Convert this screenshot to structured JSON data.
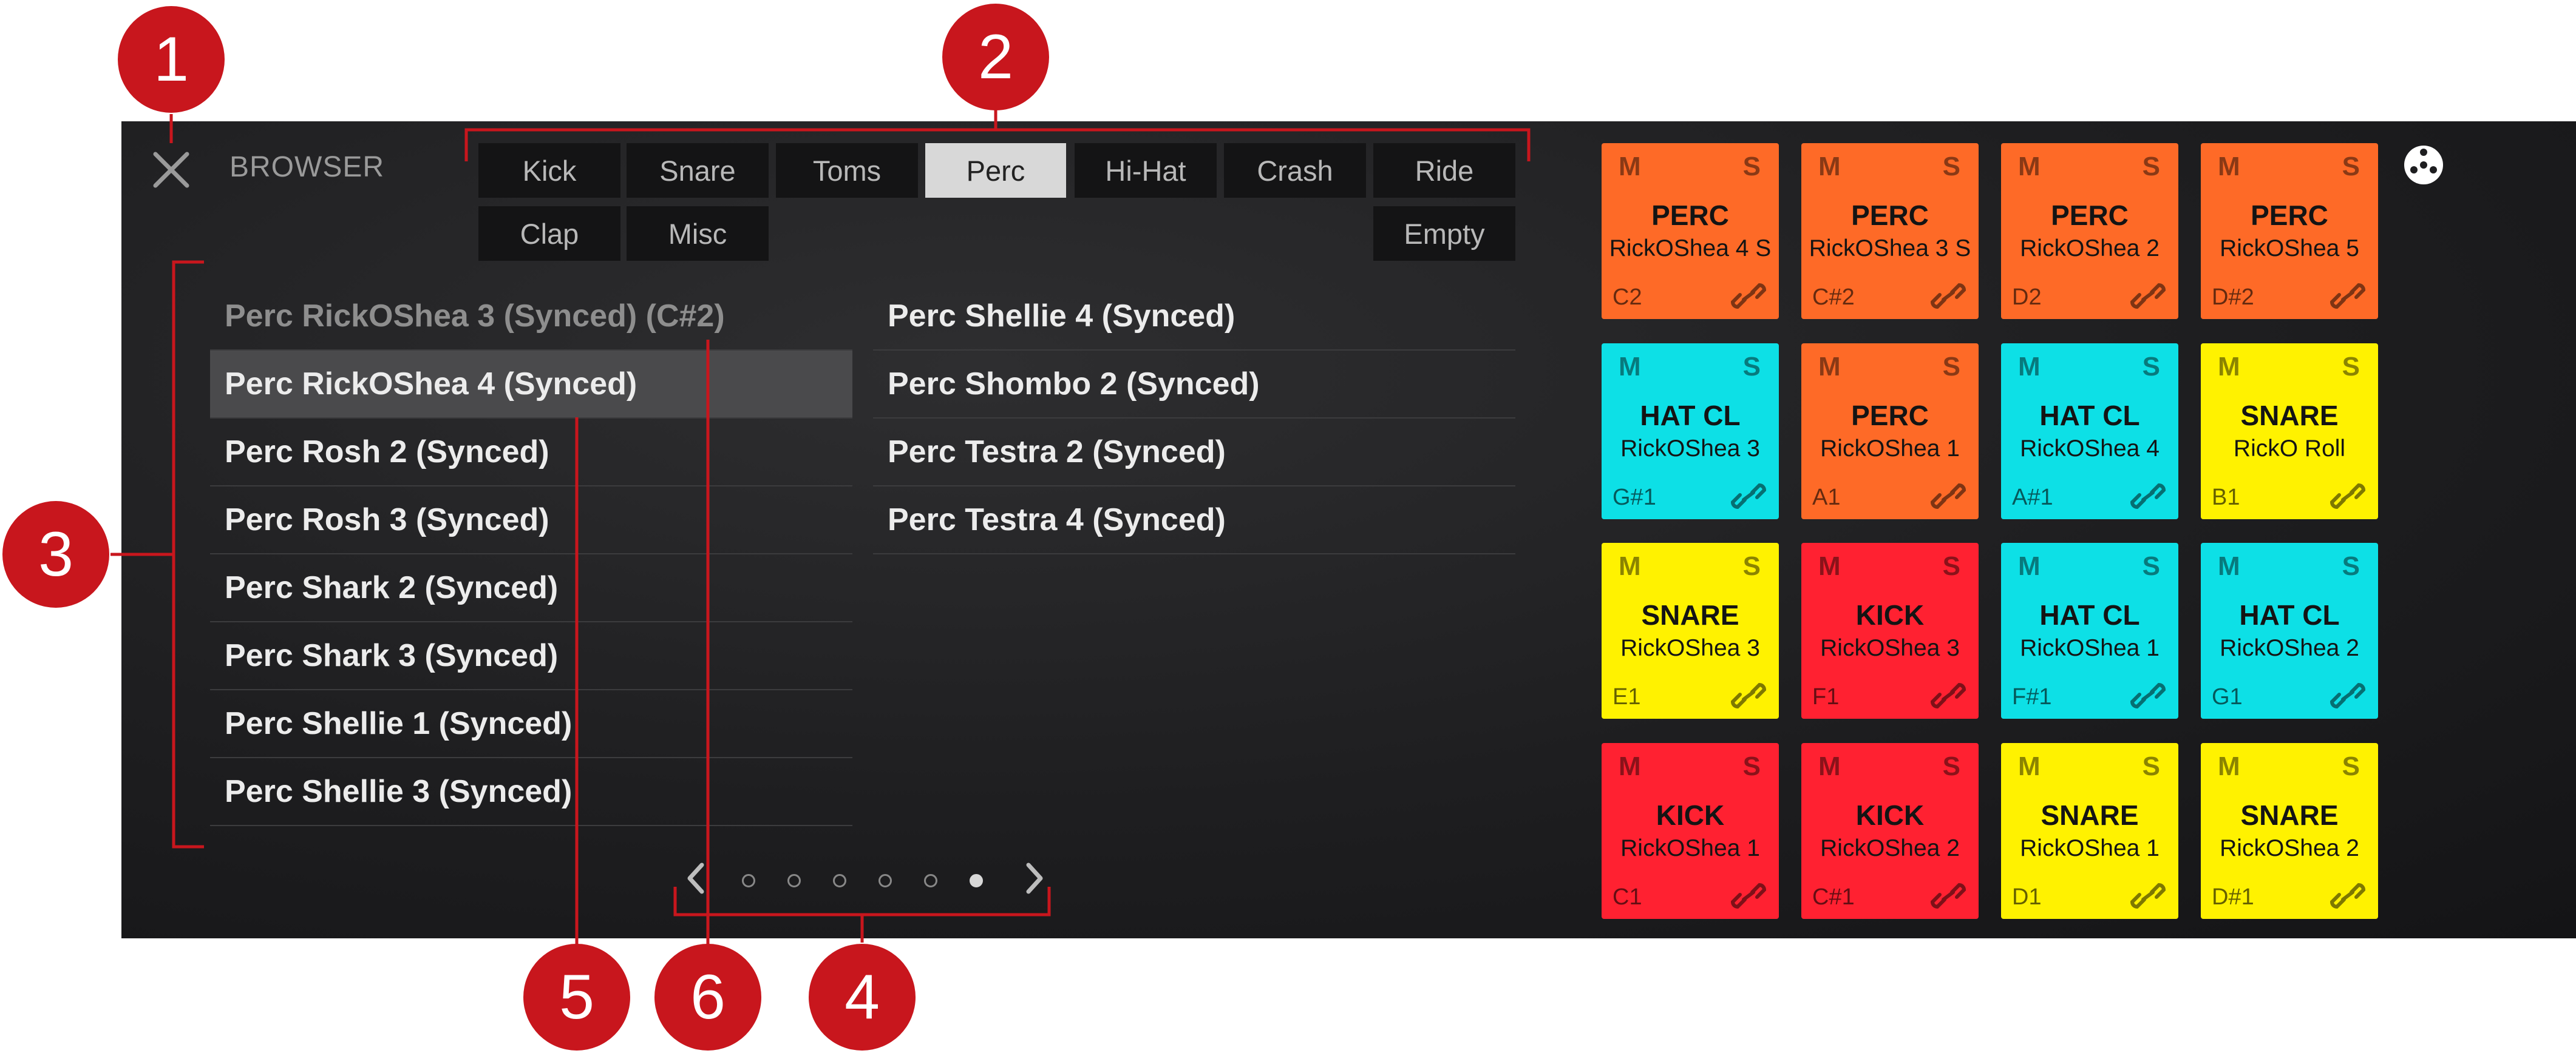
{
  "browser": {
    "title": "BROWSER",
    "close_icon": "close-icon",
    "tabs": [
      {
        "label": "Kick",
        "active": false
      },
      {
        "label": "Snare",
        "active": false
      },
      {
        "label": "Toms",
        "active": false
      },
      {
        "label": "Perc",
        "active": true
      },
      {
        "label": "Hi-Hat",
        "active": false
      },
      {
        "label": "Crash",
        "active": false
      },
      {
        "label": "Ride",
        "active": false
      },
      {
        "label": "Clap",
        "active": false
      },
      {
        "label": "Misc",
        "active": false
      },
      {
        "label": "Empty",
        "active": false
      }
    ],
    "list_left": [
      "Perc RickOShea 3 (Synced) (C#2)",
      "Perc RickOShea 4 (Synced)",
      "Perc Rosh 2 (Synced)",
      "Perc Rosh 3 (Synced)",
      "Perc Shark 2 (Synced)",
      "Perc Shark 3 (Synced)",
      "Perc Shellie 1 (Synced)",
      "Perc Shellie 3 (Synced)"
    ],
    "list_right": [
      "Perc Shellie 4 (Synced)",
      "Perc Shombo 2 (Synced)",
      "Perc Testra 2 (Synced)",
      "Perc Testra 4 (Synced)"
    ],
    "loaded_item": "Perc RickOShea 3 (Synced) (C#2)",
    "selected_item": "Perc RickOShea 4 (Synced)",
    "pager": {
      "page_count": 6,
      "current_page": 6
    }
  },
  "pads": {
    "mute_label": "M",
    "solo_label": "S",
    "settings_icon": "settings-icon",
    "colors": {
      "orange": "#fe6a27",
      "cyan": "#0de0e6",
      "yellow": "#fff200",
      "red": "#ff2131"
    },
    "items": [
      {
        "type": "PERC",
        "sample": "RickOShea 4 S",
        "note": "C2",
        "color": "orange"
      },
      {
        "type": "PERC",
        "sample": "RickOShea 3 S",
        "note": "C#2",
        "color": "orange"
      },
      {
        "type": "PERC",
        "sample": "RickOShea 2",
        "note": "D2",
        "color": "orange"
      },
      {
        "type": "PERC",
        "sample": "RickOShea 5",
        "note": "D#2",
        "color": "orange"
      },
      {
        "type": "HAT CL",
        "sample": "RickOShea 3",
        "note": "G#1",
        "color": "cyan"
      },
      {
        "type": "PERC",
        "sample": "RickOShea 1",
        "note": "A1",
        "color": "orange"
      },
      {
        "type": "HAT CL",
        "sample": "RickOShea 4",
        "note": "A#1",
        "color": "cyan"
      },
      {
        "type": "SNARE",
        "sample": "RickO Roll",
        "note": "B1",
        "color": "yellow"
      },
      {
        "type": "SNARE",
        "sample": "RickOShea 3",
        "note": "E1",
        "color": "yellow"
      },
      {
        "type": "KICK",
        "sample": "RickOShea 3",
        "note": "F1",
        "color": "red"
      },
      {
        "type": "HAT CL",
        "sample": "RickOShea 1",
        "note": "F#1",
        "color": "cyan"
      },
      {
        "type": "HAT CL",
        "sample": "RickOShea 2",
        "note": "G1",
        "color": "cyan"
      },
      {
        "type": "KICK",
        "sample": "RickOShea 1",
        "note": "C1",
        "color": "red"
      },
      {
        "type": "KICK",
        "sample": "RickOShea 2",
        "note": "C#1",
        "color": "red"
      },
      {
        "type": "SNARE",
        "sample": "RickOShea 1",
        "note": "D1",
        "color": "yellow"
      },
      {
        "type": "SNARE",
        "sample": "RickOShea 2",
        "note": "D#1",
        "color": "yellow"
      }
    ]
  },
  "callouts": [
    "1",
    "2",
    "3",
    "4",
    "5",
    "6"
  ],
  "accent_color": "#c8161d"
}
